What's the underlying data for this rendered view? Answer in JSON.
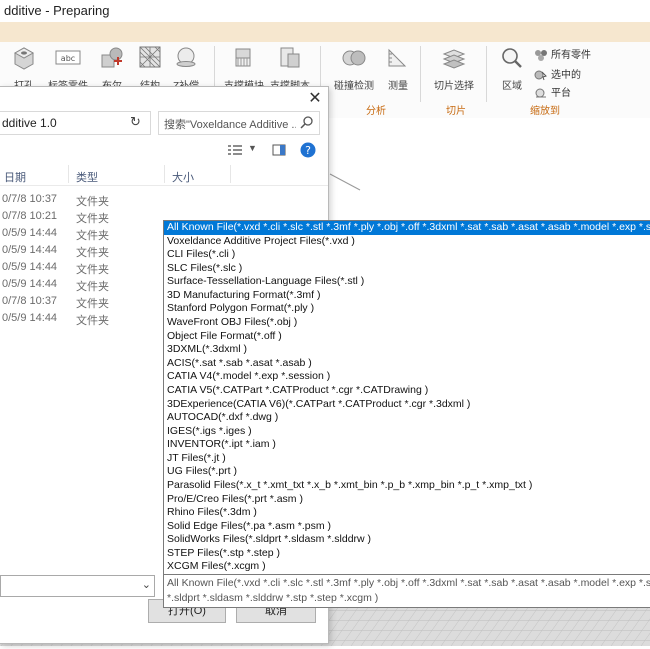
{
  "window": {
    "title": "dditive - Preparing"
  },
  "ribbon": {
    "tools": [
      {
        "label": "打孔",
        "icon": "cube-hole-icon"
      },
      {
        "label": "标签零件",
        "icon": "label-tag-icon"
      },
      {
        "label": "布尔",
        "icon": "boolean-icon"
      },
      {
        "label": "结构",
        "icon": "lattice-icon"
      },
      {
        "label": "Z补偿",
        "icon": "z-compensation-icon"
      },
      {
        "label": "支撑模块",
        "icon": "support-module-icon"
      },
      {
        "label": "支撑脚本",
        "icon": "support-script-icon"
      },
      {
        "label": "碰撞检测",
        "icon": "collision-icon"
      },
      {
        "label": "测量",
        "icon": "ruler-icon"
      },
      {
        "label": "切片选择",
        "icon": "slice-icon"
      },
      {
        "label": "区域",
        "icon": "magnifier-icon"
      }
    ],
    "zoom_options": [
      {
        "label": "所有零件",
        "icon": "all-parts-icon"
      },
      {
        "label": "选中的",
        "icon": "selected-icon"
      },
      {
        "label": "平台",
        "icon": "platform-icon"
      }
    ],
    "groups": {
      "analysis": "分析",
      "slice": "切片",
      "zoom": "缩放到"
    },
    "accent_color": "#c76a10"
  },
  "dialog": {
    "path": "dditive 1.0",
    "search_placeholder": "搜索\"Voxeldance Additive ...",
    "columns": {
      "date": "日期",
      "type": "类型",
      "size": "大小"
    },
    "rows": [
      {
        "date": "0/7/8 10:37",
        "type": "文件夹"
      },
      {
        "date": "0/7/8 10:21",
        "type": "文件夹"
      },
      {
        "date": "0/5/9 14:44",
        "type": "文件夹"
      },
      {
        "date": "0/5/9 14:44",
        "type": "文件夹"
      },
      {
        "date": "0/5/9 14:44",
        "type": "文件夹"
      },
      {
        "date": "0/5/9 14:44",
        "type": "文件夹"
      },
      {
        "date": "0/7/8 10:37",
        "type": "文件夹"
      },
      {
        "date": "0/5/9 14:44",
        "type": "文件夹"
      }
    ],
    "open_label": "打开(O)",
    "cancel_label": "取消"
  },
  "filetypes": {
    "options": [
      "All Known File(*.vxd *.cli *.slc *.stl *.3mf *.ply *.obj *.off *.3dxml *.sat *.sab *.asat *.asab *.model *.exp *.session",
      "Voxeldance Additive Project Files(*.vxd )",
      "CLI Files(*.cli )",
      "SLC Files(*.slc )",
      "Surface-Tessellation-Language Files(*.stl )",
      "3D Manufacturing Format(*.3mf )",
      "Stanford Polygon Format(*.ply )",
      "WaveFront OBJ Files(*.obj )",
      "Object File Format(*.off )",
      "3DXML(*.3dxml )",
      "ACIS(*.sat *.sab *.asat *.asab )",
      "CATIA V4(*.model *.exp *.session )",
      "CATIA V5(*.CATPart *.CATProduct *.cgr *.CATDrawing )",
      "3DExperience(CATIA V6)(*.CATPart *.CATProduct *.cgr *.3dxml )",
      "AUTOCAD(*.dxf *.dwg )",
      "IGES(*.igs *.iges )",
      "INVENTOR(*.ipt *.iam )",
      "JT Files(*.jt )",
      "UG Files(*.prt )",
      "Parasolid Files(*.x_t *.xmt_txt *.x_b *.xmt_bin *.p_b *.xmp_bin *.p_t *.xmp_txt )",
      "Pro/E/Creo Files(*.prt *.asm )",
      "Rhino Files(*.3dm )",
      "Solid Edge Files(*.pa *.asm *.psm )",
      "SolidWorks Files(*.sldprt *.sldasm *.slddrw )",
      "STEP Files(*.stp *.step )",
      "XCGM Files(*.xcgm )"
    ],
    "selected_index": 0,
    "selected_line1": "All Known File(*.vxd *.cli *.slc *.stl *.3mf *.ply *.obj *.off *.3dxml *.sat *.sab *.asat *.asab *.model *.exp *.session",
    "selected_line2": "*.sldprt *.sldasm *.slddrw *.stp *.step *.xcgm )"
  }
}
